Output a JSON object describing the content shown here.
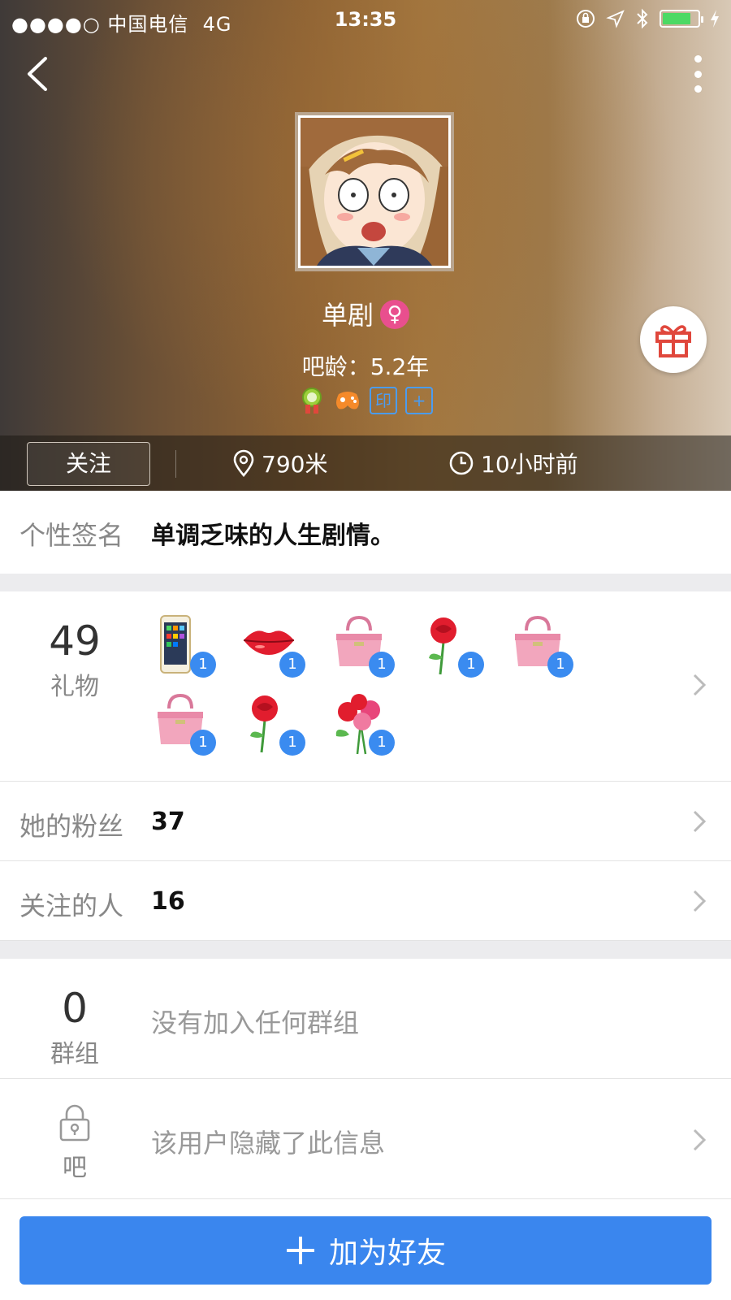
{
  "status_bar": {
    "signal": "●●●●○",
    "carrier": "中国电信",
    "network": "4G",
    "time": "13:35"
  },
  "profile": {
    "name": "单剧",
    "gender_symbol": "♀",
    "tieba_age": "吧龄：5.2年",
    "badge_box_1": "印",
    "badge_box_2": "+"
  },
  "actions": {
    "follow_label": "关注",
    "distance": "790米",
    "last_active": "10小时前"
  },
  "signature": {
    "label": "个性签名",
    "value": "单调乏味的人生剧情。"
  },
  "gifts": {
    "count": "49",
    "label": "礼物",
    "items": [
      {
        "icon": "phone-gift-icon",
        "count": "1"
      },
      {
        "icon": "lips-gift-icon",
        "count": "1"
      },
      {
        "icon": "handbag-gift-icon",
        "count": "1"
      },
      {
        "icon": "rose-gift-icon",
        "count": "1"
      },
      {
        "icon": "handbag-gift-icon",
        "count": "1"
      },
      {
        "icon": "handbag-gift-icon",
        "count": "1"
      },
      {
        "icon": "rose-gift-icon",
        "count": "1"
      },
      {
        "icon": "bouquet-gift-icon",
        "count": "1"
      }
    ]
  },
  "fans": {
    "label": "她的粉丝",
    "count": "37"
  },
  "following": {
    "label": "关注的人",
    "count": "16"
  },
  "groups": {
    "count": "0",
    "label": "群组",
    "text": "没有加入任何群组"
  },
  "tieba": {
    "label": "吧",
    "text": "该用户隐藏了此信息"
  },
  "add_friend": {
    "label": "加为好友"
  },
  "colors": {
    "accent": "#3a86ee",
    "badge": "#3a8bf0",
    "female": "#e94f8e"
  }
}
